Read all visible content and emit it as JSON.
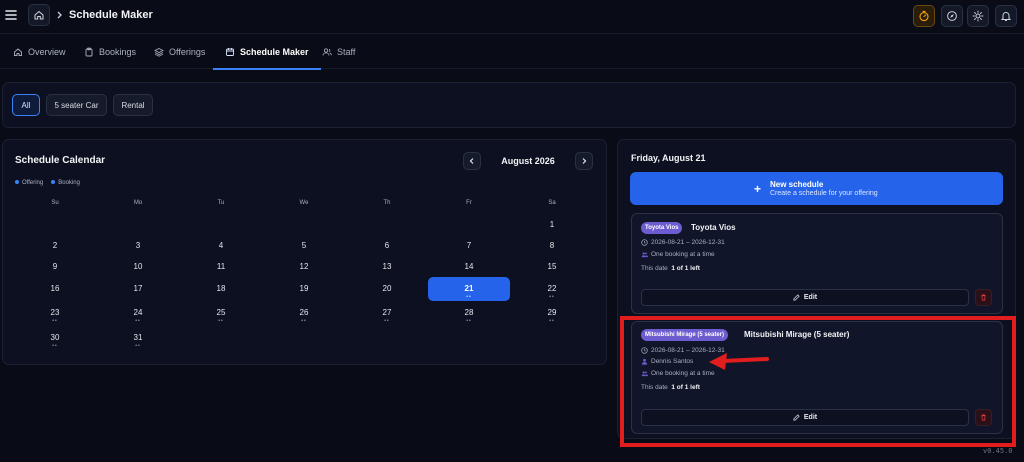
{
  "header": {
    "title": "Schedule Maker",
    "icons": [
      "menu-icon",
      "home-icon",
      "chevron-right-icon",
      "timer-icon",
      "compass-icon",
      "sun-icon",
      "bell-icon"
    ]
  },
  "tabs": [
    {
      "label": "Overview",
      "icon": "home-icon"
    },
    {
      "label": "Bookings",
      "icon": "clipboard-icon"
    },
    {
      "label": "Offerings",
      "icon": "layers-icon"
    },
    {
      "label": "Schedule Maker",
      "icon": "calendar-icon",
      "active": true
    },
    {
      "label": "Staff",
      "icon": "users-icon"
    }
  ],
  "filters": [
    {
      "label": "All",
      "active": true
    },
    {
      "label": "5 seater Car"
    },
    {
      "label": "Rental"
    }
  ],
  "calendar": {
    "title": "Schedule Calendar",
    "legend": [
      "Offering",
      "Booking"
    ],
    "month": "August 2026",
    "weekdays": [
      "Su",
      "Mo",
      "Tu",
      "We",
      "Th",
      "Fr",
      "Sa"
    ],
    "selected_day": "21",
    "weeks": [
      [
        null,
        null,
        null,
        null,
        null,
        null,
        {
          "d": "1"
        }
      ],
      [
        {
          "d": "2"
        },
        {
          "d": "3"
        },
        {
          "d": "4"
        },
        {
          "d": "5"
        },
        {
          "d": "6"
        },
        {
          "d": "7"
        },
        {
          "d": "8"
        }
      ],
      [
        {
          "d": "9"
        },
        {
          "d": "10"
        },
        {
          "d": "11"
        },
        {
          "d": "12"
        },
        {
          "d": "13"
        },
        {
          "d": "14"
        },
        {
          "d": "15"
        }
      ],
      [
        {
          "d": "16"
        },
        {
          "d": "17"
        },
        {
          "d": "18"
        },
        {
          "d": "19"
        },
        {
          "d": "20"
        },
        {
          "d": "21",
          "dots": true
        },
        {
          "d": "22",
          "dots": true
        }
      ],
      [
        {
          "d": "23",
          "dots": true
        },
        {
          "d": "24",
          "dots": true
        },
        {
          "d": "25",
          "dots": true
        },
        {
          "d": "26",
          "dots": true
        },
        {
          "d": "27",
          "dots": true
        },
        {
          "d": "28",
          "dots": true
        },
        {
          "d": "29",
          "dots": true
        }
      ],
      [
        {
          "d": "30",
          "dots": true
        },
        {
          "d": "31",
          "dots": true
        },
        null,
        null,
        null,
        null,
        null
      ]
    ]
  },
  "side": {
    "date_heading": "Friday, August 21",
    "new_schedule": {
      "title": "New schedule",
      "subtitle": "Create a schedule for your offering"
    },
    "schedules": [
      {
        "tag": "Toyota Vios",
        "name": "Toyota Vios",
        "dates": "2026-08-21 – 2026-12-31",
        "booking": "One booking at a time",
        "left_label": "This date",
        "left_value": "1 of 1 left",
        "edit": "Edit"
      },
      {
        "tag": "Mitsubishi Mirage (5 seater)",
        "name": "Mitsubishi Mirage (5 seater)",
        "dates": "2026-08-21 – 2026-12-31",
        "staff": "Dennis Santos",
        "booking": "One booking at a time",
        "left_label": "This date",
        "left_value": "1 of 1 left",
        "edit": "Edit"
      }
    ]
  },
  "version": "v0.45.0",
  "colors": {
    "accent": "#2563eb",
    "annotation": "#e11d1d",
    "tag": "#6d5bd0"
  }
}
